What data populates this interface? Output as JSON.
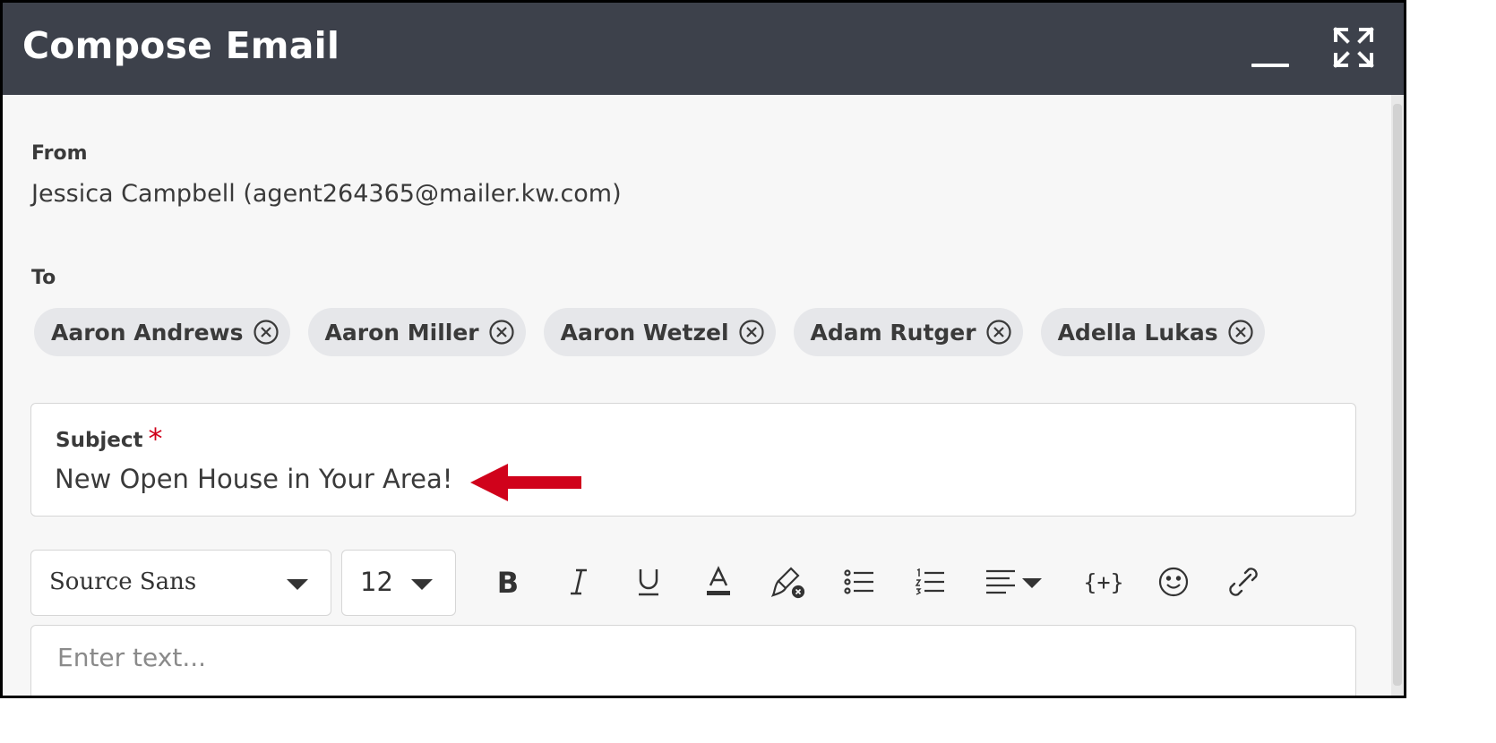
{
  "window": {
    "title": "Compose Email",
    "minimize_icon": "minimize-icon",
    "expand_icon": "expand-icon",
    "header_color": "#3d414b"
  },
  "from": {
    "label": "From",
    "value": "Jessica Campbell (agent264365@mailer.kw.com)"
  },
  "to": {
    "label": "To",
    "recipients": [
      {
        "name": "Aaron Andrews"
      },
      {
        "name": "Aaron Miller"
      },
      {
        "name": "Aaron Wetzel"
      },
      {
        "name": "Adam Rutger"
      },
      {
        "name": "Adella Lukas"
      }
    ]
  },
  "subject": {
    "label": "Subject",
    "required_mark": "*",
    "value": "New Open House in Your Area!",
    "required_color": "#d0021b"
  },
  "annotation": {
    "icon": "red-arrow-pointing-left",
    "color": "#d0021b"
  },
  "toolbar": {
    "font_family": "Source Sans",
    "font_size": "12",
    "tools": [
      "bold-icon",
      "italic-icon",
      "underline-icon",
      "text-color-icon",
      "clear-formatting-icon",
      "bulleted-list-icon",
      "numbered-list-icon",
      "align-icon",
      "insert-variable-icon",
      "emoji-icon",
      "link-icon"
    ],
    "insert_variable_glyph": "{+}"
  },
  "editor": {
    "placeholder": "Enter text..."
  }
}
